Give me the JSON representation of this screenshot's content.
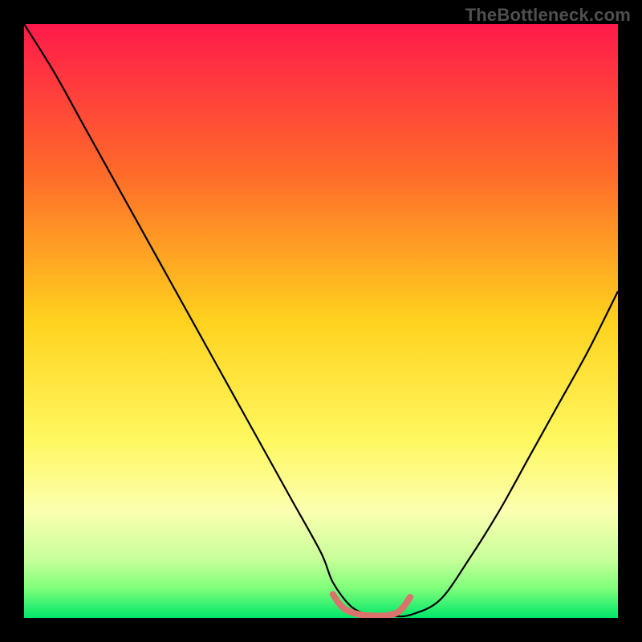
{
  "watermark": "TheBottleneck.com",
  "chart_data": {
    "type": "line",
    "title": "",
    "xlabel": "",
    "ylabel": "",
    "xlim": [
      0,
      100
    ],
    "ylim": [
      0,
      100
    ],
    "grid": false,
    "legend": false,
    "background_gradient": {
      "stops": [
        {
          "offset": 0.0,
          "color": "#ff1a4b"
        },
        {
          "offset": 0.25,
          "color": "#ff6a2a"
        },
        {
          "offset": 0.5,
          "color": "#ffd21e"
        },
        {
          "offset": 0.7,
          "color": "#fff860"
        },
        {
          "offset": 0.82,
          "color": "#fbffb0"
        },
        {
          "offset": 0.9,
          "color": "#c9ff9a"
        },
        {
          "offset": 0.95,
          "color": "#7fff7a"
        },
        {
          "offset": 1.0,
          "color": "#00e66a"
        }
      ]
    },
    "series": [
      {
        "name": "bottleneck-curve",
        "stroke": "#000000",
        "stroke_width": 2.2,
        "x": [
          0,
          5,
          10,
          15,
          20,
          25,
          30,
          35,
          40,
          45,
          50,
          52,
          55,
          58,
          60,
          62,
          65,
          70,
          75,
          80,
          85,
          90,
          95,
          100
        ],
        "y": [
          100,
          92,
          83,
          74,
          65,
          56,
          47,
          38,
          29,
          20,
          11,
          6,
          2,
          0.5,
          0.3,
          0.3,
          0.5,
          3,
          10,
          18,
          27,
          36,
          45,
          55
        ]
      },
      {
        "name": "optimal-band",
        "stroke": "#d9736b",
        "stroke_width": 8,
        "linecap": "round",
        "x": [
          52,
          53,
          54,
          55,
          56,
          57,
          58,
          59,
          60,
          61,
          62,
          63,
          64,
          65
        ],
        "y": [
          4.0,
          2.5,
          1.5,
          1.0,
          0.7,
          0.5,
          0.4,
          0.35,
          0.35,
          0.4,
          0.6,
          1.0,
          2.0,
          3.5
        ]
      }
    ],
    "annotations": []
  }
}
